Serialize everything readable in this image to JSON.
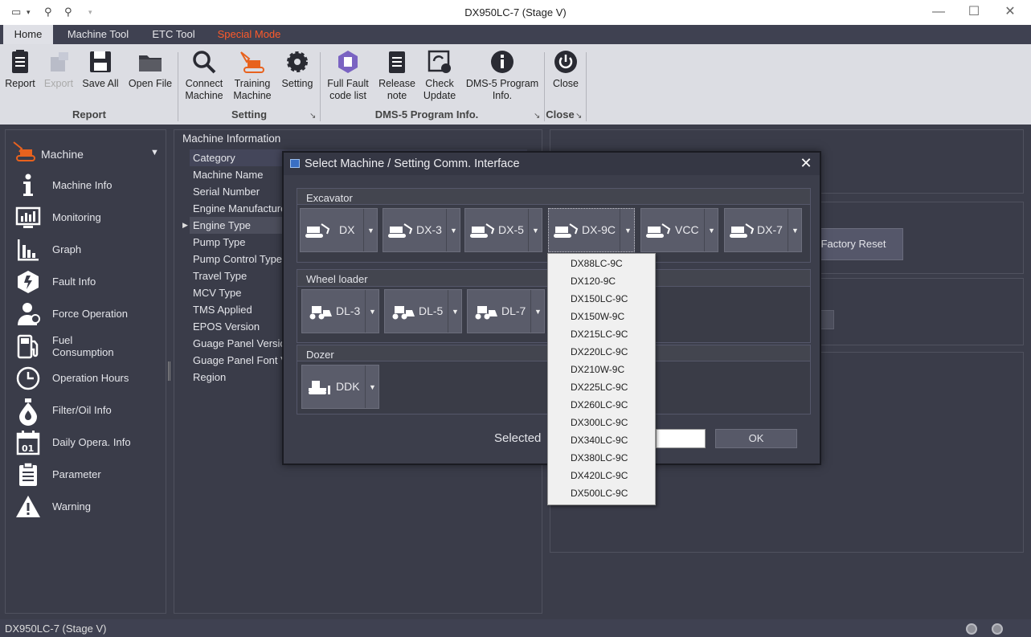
{
  "window": {
    "title": "DX950LC-7 (Stage V)",
    "controls": {
      "minimize": "—",
      "maximize": "☐",
      "close": "✕"
    },
    "quick_access": [
      "screen-icon",
      "link-icon",
      "link-icon",
      "customize-icon"
    ]
  },
  "tabs": [
    {
      "label": "Home",
      "active": true
    },
    {
      "label": "Machine Tool"
    },
    {
      "label": "ETC Tool"
    },
    {
      "label": "Special Mode",
      "color": "#ff5a2a"
    }
  ],
  "ribbon": {
    "groups": [
      {
        "title": "Report",
        "buttons": [
          {
            "label": "Report",
            "icon": "report-icon"
          },
          {
            "label": "Export",
            "icon": "export-icon",
            "disabled": true
          },
          {
            "label": "Save All",
            "icon": "save-icon"
          },
          {
            "label": "Open File",
            "icon": "folder-icon"
          }
        ]
      },
      {
        "title": "Setting",
        "buttons": [
          {
            "label": "Connect Machine",
            "line1": "Connect",
            "line2": "Machine",
            "icon": "search-icon"
          },
          {
            "label": "Training Machine",
            "line1": "Training",
            "line2": "Machine",
            "icon": "excavator-icon"
          },
          {
            "label": "Setting",
            "icon": "gear-icon"
          }
        ]
      },
      {
        "title": "DMS-5 Program Info.",
        "buttons": [
          {
            "label": "Full Fault code list",
            "line1": "Full Fault",
            "line2": "code list",
            "icon": "fault-list-icon"
          },
          {
            "label": "Release note",
            "line1": "Release",
            "line2": "note",
            "icon": "release-note-icon"
          },
          {
            "label": "Check Update",
            "line1": "Check",
            "line2": "Update",
            "icon": "update-icon"
          },
          {
            "label": "DMS-5 Program Info.",
            "line1": "DMS-5 Program",
            "line2": "Info.",
            "icon": "info-icon"
          }
        ]
      },
      {
        "title": "Close",
        "buttons": [
          {
            "label": "Close",
            "icon": "power-icon"
          }
        ]
      }
    ]
  },
  "sidebar": {
    "header": "Machine",
    "items": [
      {
        "label": "Machine Info",
        "icon": "info-icon"
      },
      {
        "label": "Monitoring",
        "icon": "monitor-icon"
      },
      {
        "label": "Graph",
        "icon": "graph-icon"
      },
      {
        "label": "Fault Info",
        "icon": "fault-icon"
      },
      {
        "label": "Force Operation",
        "icon": "person-icon"
      },
      {
        "label": "Fuel Consumption",
        "line1": "Fuel",
        "line2": "Consumption",
        "icon": "fuel-icon"
      },
      {
        "label": "Operation Hours",
        "icon": "clock-icon"
      },
      {
        "label": "Filter/Oil Info",
        "icon": "oil-drop-icon"
      },
      {
        "label": "Daily Opera. Info",
        "icon": "calendar-icon"
      },
      {
        "label": "Parameter",
        "icon": "clipboard-icon"
      },
      {
        "label": "Warning",
        "icon": "warning-icon"
      }
    ]
  },
  "machine_info": {
    "title": "Machine Information",
    "rows": [
      "Category",
      "Machine Name",
      "Serial Number",
      "Engine Manufacturer",
      "Engine Type",
      "Pump Type",
      "Pump Control Type",
      "Travel Type",
      "MCV Type",
      "TMS Applied",
      "EPOS Version",
      "Guage Panel Version",
      "Guage Panel Font Ve",
      "Region"
    ],
    "selected_row": 4
  },
  "right_panel": {
    "factory_reset": "Factory Reset"
  },
  "dialog": {
    "title": "Select Machine / Setting Comm. Interface",
    "close": "✕",
    "groups": [
      {
        "label": "Excavator",
        "buttons": [
          "DX",
          "DX-3",
          "DX-5",
          "DX-9C",
          "VCC",
          "DX-7"
        ],
        "focused": 3
      },
      {
        "label": "Wheel loader",
        "buttons": [
          "DL-3",
          "DL-5",
          "DL-7"
        ]
      },
      {
        "label": "Dozer",
        "buttons": [
          "DDK"
        ]
      }
    ],
    "selected_label": "Selected",
    "ok": "OK"
  },
  "dropdown": {
    "items": [
      "DX88LC-9C",
      "DX120-9C",
      "DX150LC-9C",
      "DX150W-9C",
      "DX215LC-9C",
      "DX220LC-9C",
      "DX210W-9C",
      "DX225LC-9C",
      "DX260LC-9C",
      "DX300LC-9C",
      "DX340LC-9C",
      "DX380LC-9C",
      "DX420LC-9C",
      "DX500LC-9C"
    ]
  },
  "status": {
    "text": "DX950LC-7 (Stage V)"
  }
}
